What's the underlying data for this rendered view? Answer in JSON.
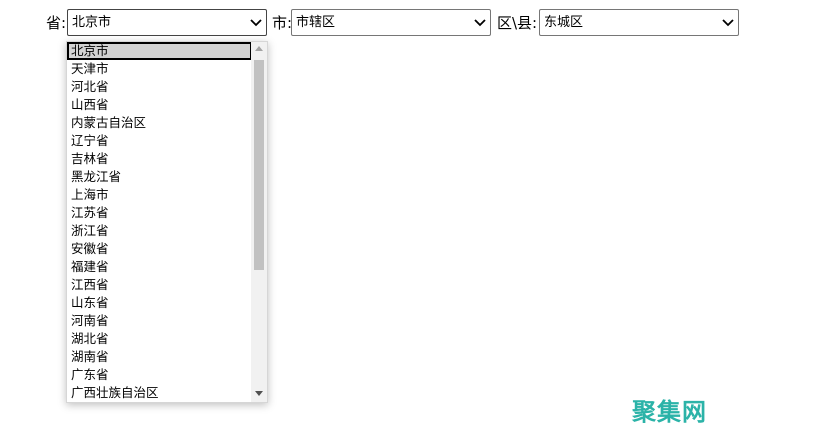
{
  "labels": {
    "province": "省:",
    "city": "市:",
    "district": "区\\县:"
  },
  "selects": {
    "province": {
      "value": "北京市"
    },
    "city": {
      "value": "市辖区"
    },
    "district": {
      "value": "东城区"
    }
  },
  "province_options": [
    "北京市",
    "天津市",
    "河北省",
    "山西省",
    "内蒙古自治区",
    "辽宁省",
    "吉林省",
    "黑龙江省",
    "上海市",
    "江苏省",
    "浙江省",
    "安徽省",
    "福建省",
    "江西省",
    "山东省",
    "河南省",
    "湖北省",
    "湖南省",
    "广东省",
    "广西壮族自治区"
  ],
  "selected_index": 0,
  "watermark": "聚集网",
  "colors": {
    "watermark": "#2bb3a8",
    "selected_bg": "#d3d3d3"
  },
  "icons": {
    "select_arrow": "chevron-down-icon"
  }
}
